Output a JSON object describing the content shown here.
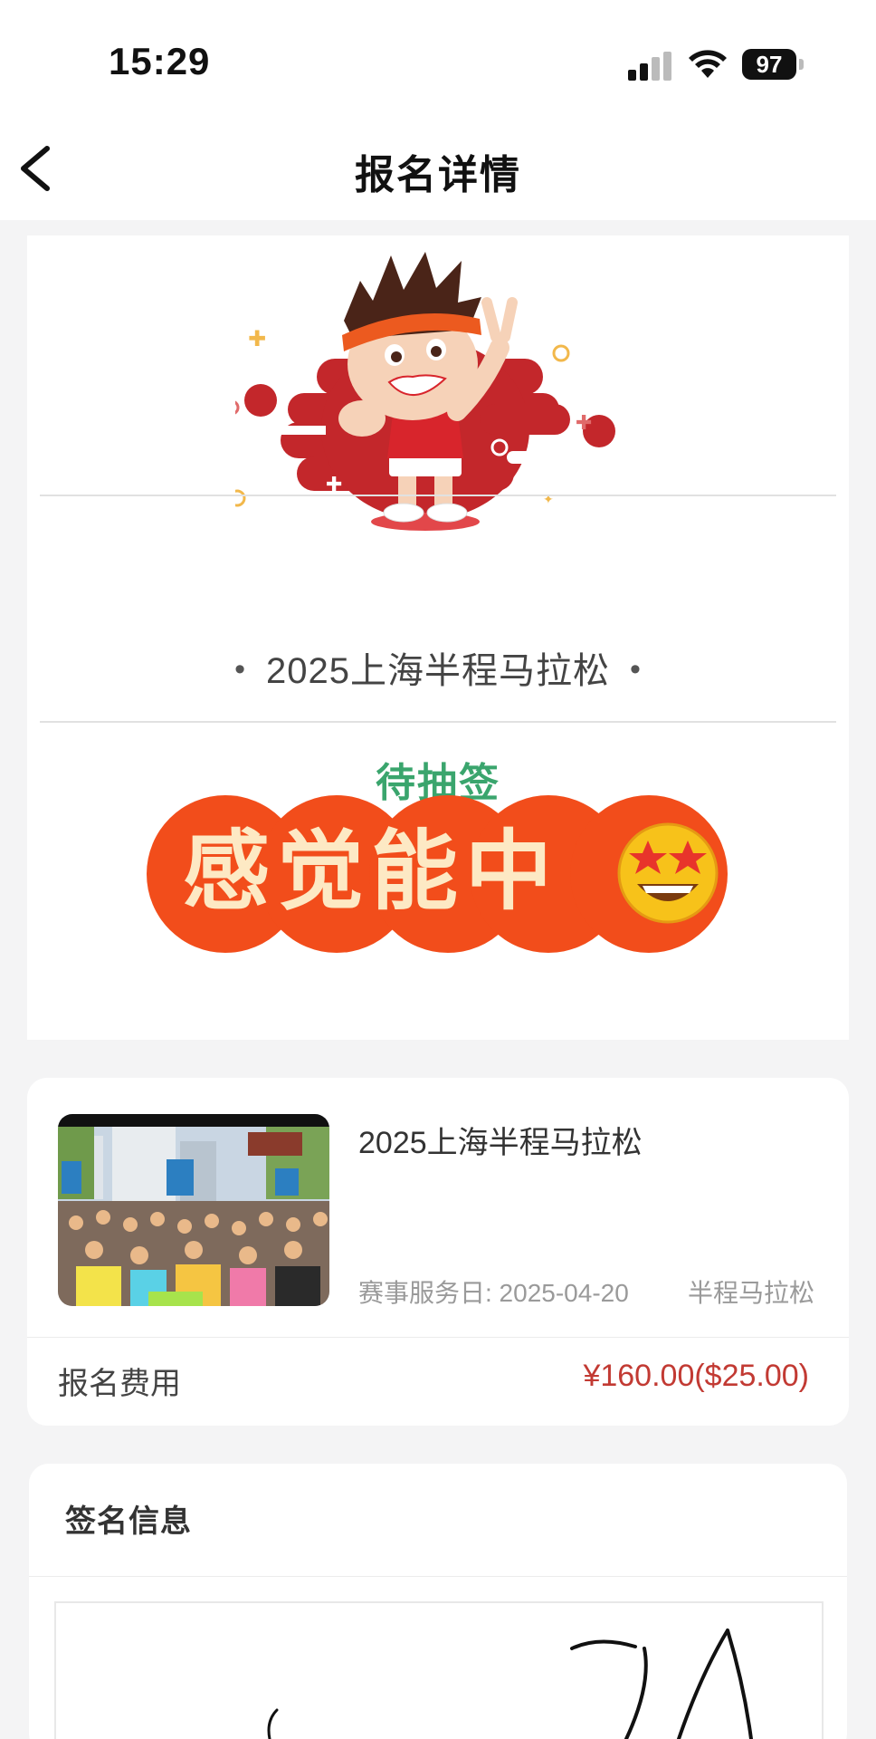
{
  "status_bar": {
    "time": "15:29",
    "battery": "97",
    "icons": [
      "cellular-signal-icon",
      "wifi-icon",
      "battery-icon"
    ]
  },
  "nav": {
    "back_icon": "chevron-left-icon",
    "title": "报名详情"
  },
  "hero": {
    "event_name": "2025上海半程马拉松",
    "status": "待抽签",
    "banner_text": "感觉能中",
    "banner_emoji": "star-struck-emoji",
    "colors": {
      "status": "#3aa56d",
      "banner": "#f24d1b",
      "mascot_red": "#c3272b"
    }
  },
  "event_card": {
    "title": "2025上海半程马拉松",
    "date_label": "赛事服务日: 2025-04-20",
    "race_type": "半程马拉松",
    "fee_label": "报名费用",
    "fee_value": "¥160.00($25.00)",
    "colors": {
      "fee": "#c23a33"
    }
  },
  "signature": {
    "title": "签名信息"
  }
}
